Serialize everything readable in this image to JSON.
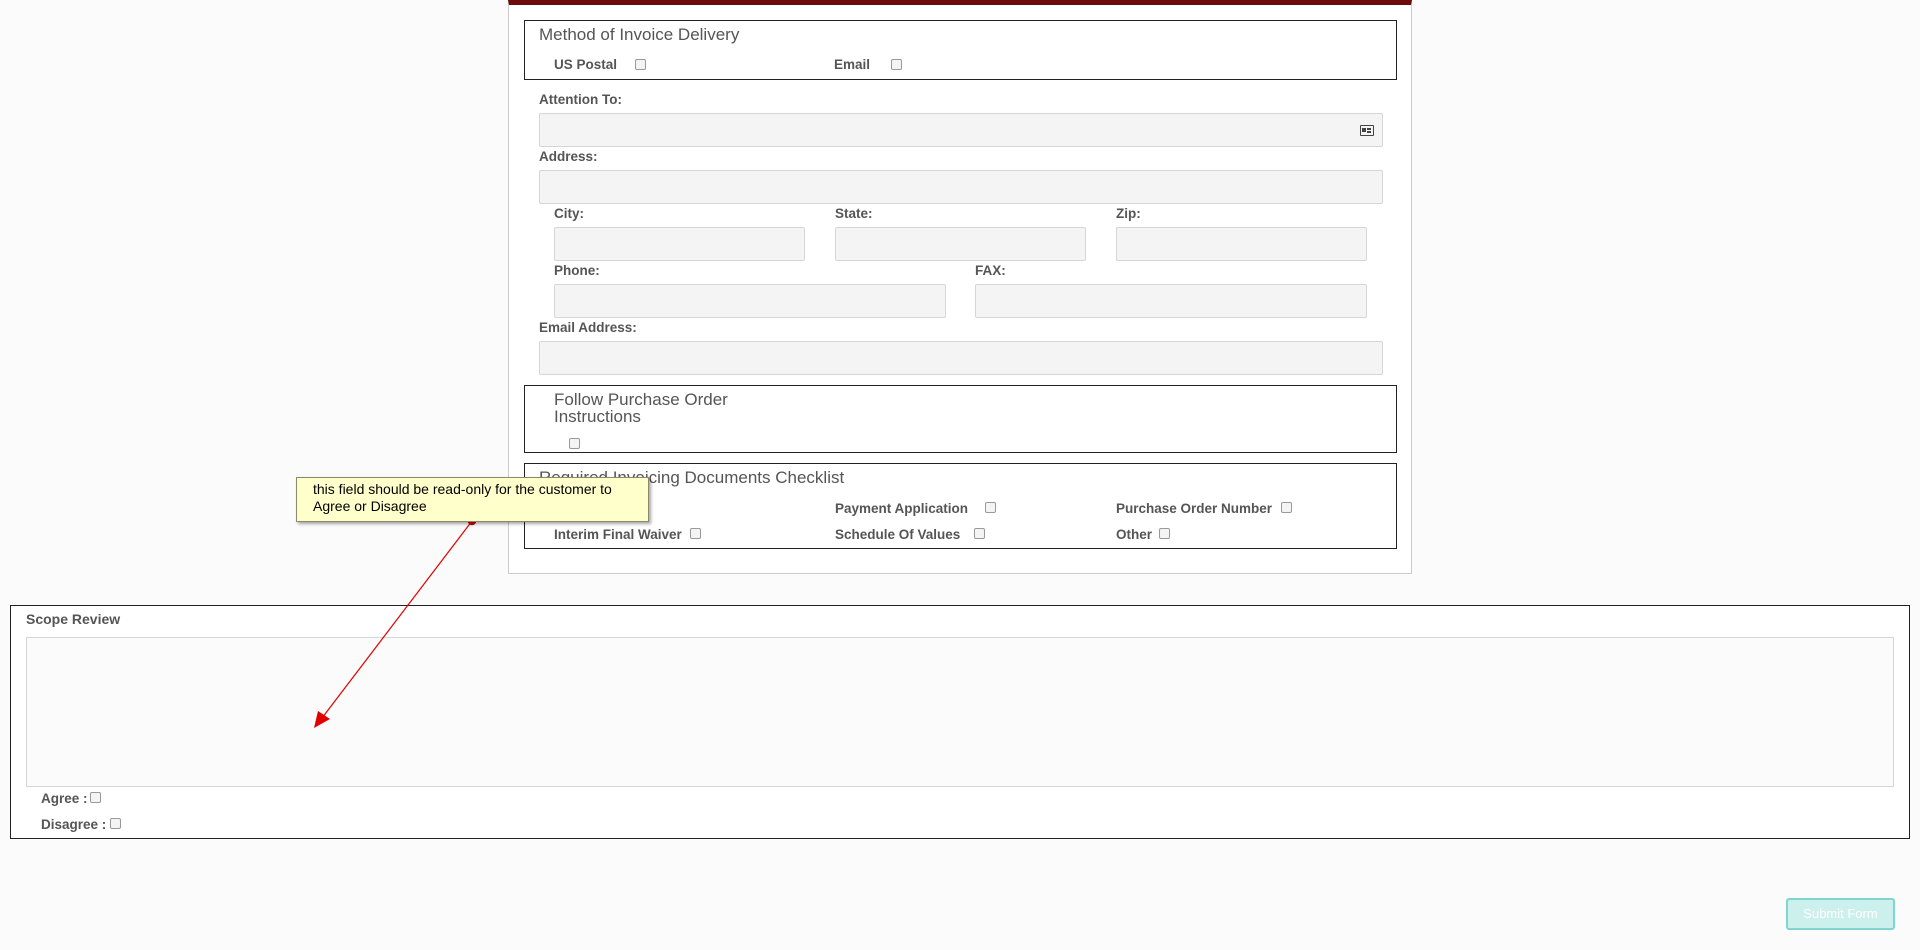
{
  "invoice_delivery": {
    "legend": "Method of Invoice Delivery",
    "us_postal_label": "US Postal",
    "email_label": "Email"
  },
  "contact": {
    "attention_label": "Attention To:",
    "attention_value": "",
    "address_label": "Address:",
    "address_value": "",
    "city_label": "City:",
    "state_label": "State:",
    "zip_label": "Zip:",
    "phone_label": "Phone:",
    "fax_label": "FAX:",
    "email_address_label": "Email Address:"
  },
  "po_instructions": {
    "legend_line1": "Follow Purchase Order",
    "legend_line2": "Instructions"
  },
  "checklist": {
    "legend": "Required Invoicing Documents Checklist",
    "payment_application": "Payment Application",
    "purchase_order_number": "Purchase Order Number",
    "interim_final_waiver": "Interim Final Waiver",
    "schedule_of_values": "Schedule Of Values",
    "other": "Other"
  },
  "scope": {
    "label": "Scope Review",
    "value": "",
    "agree_label": "Agree :",
    "disagree_label": "Disagree :"
  },
  "annotation": {
    "text": "this field should be read-only for the customer to Agree or Disagree",
    "color": "#e00000"
  },
  "submit_label": "Submit Form"
}
